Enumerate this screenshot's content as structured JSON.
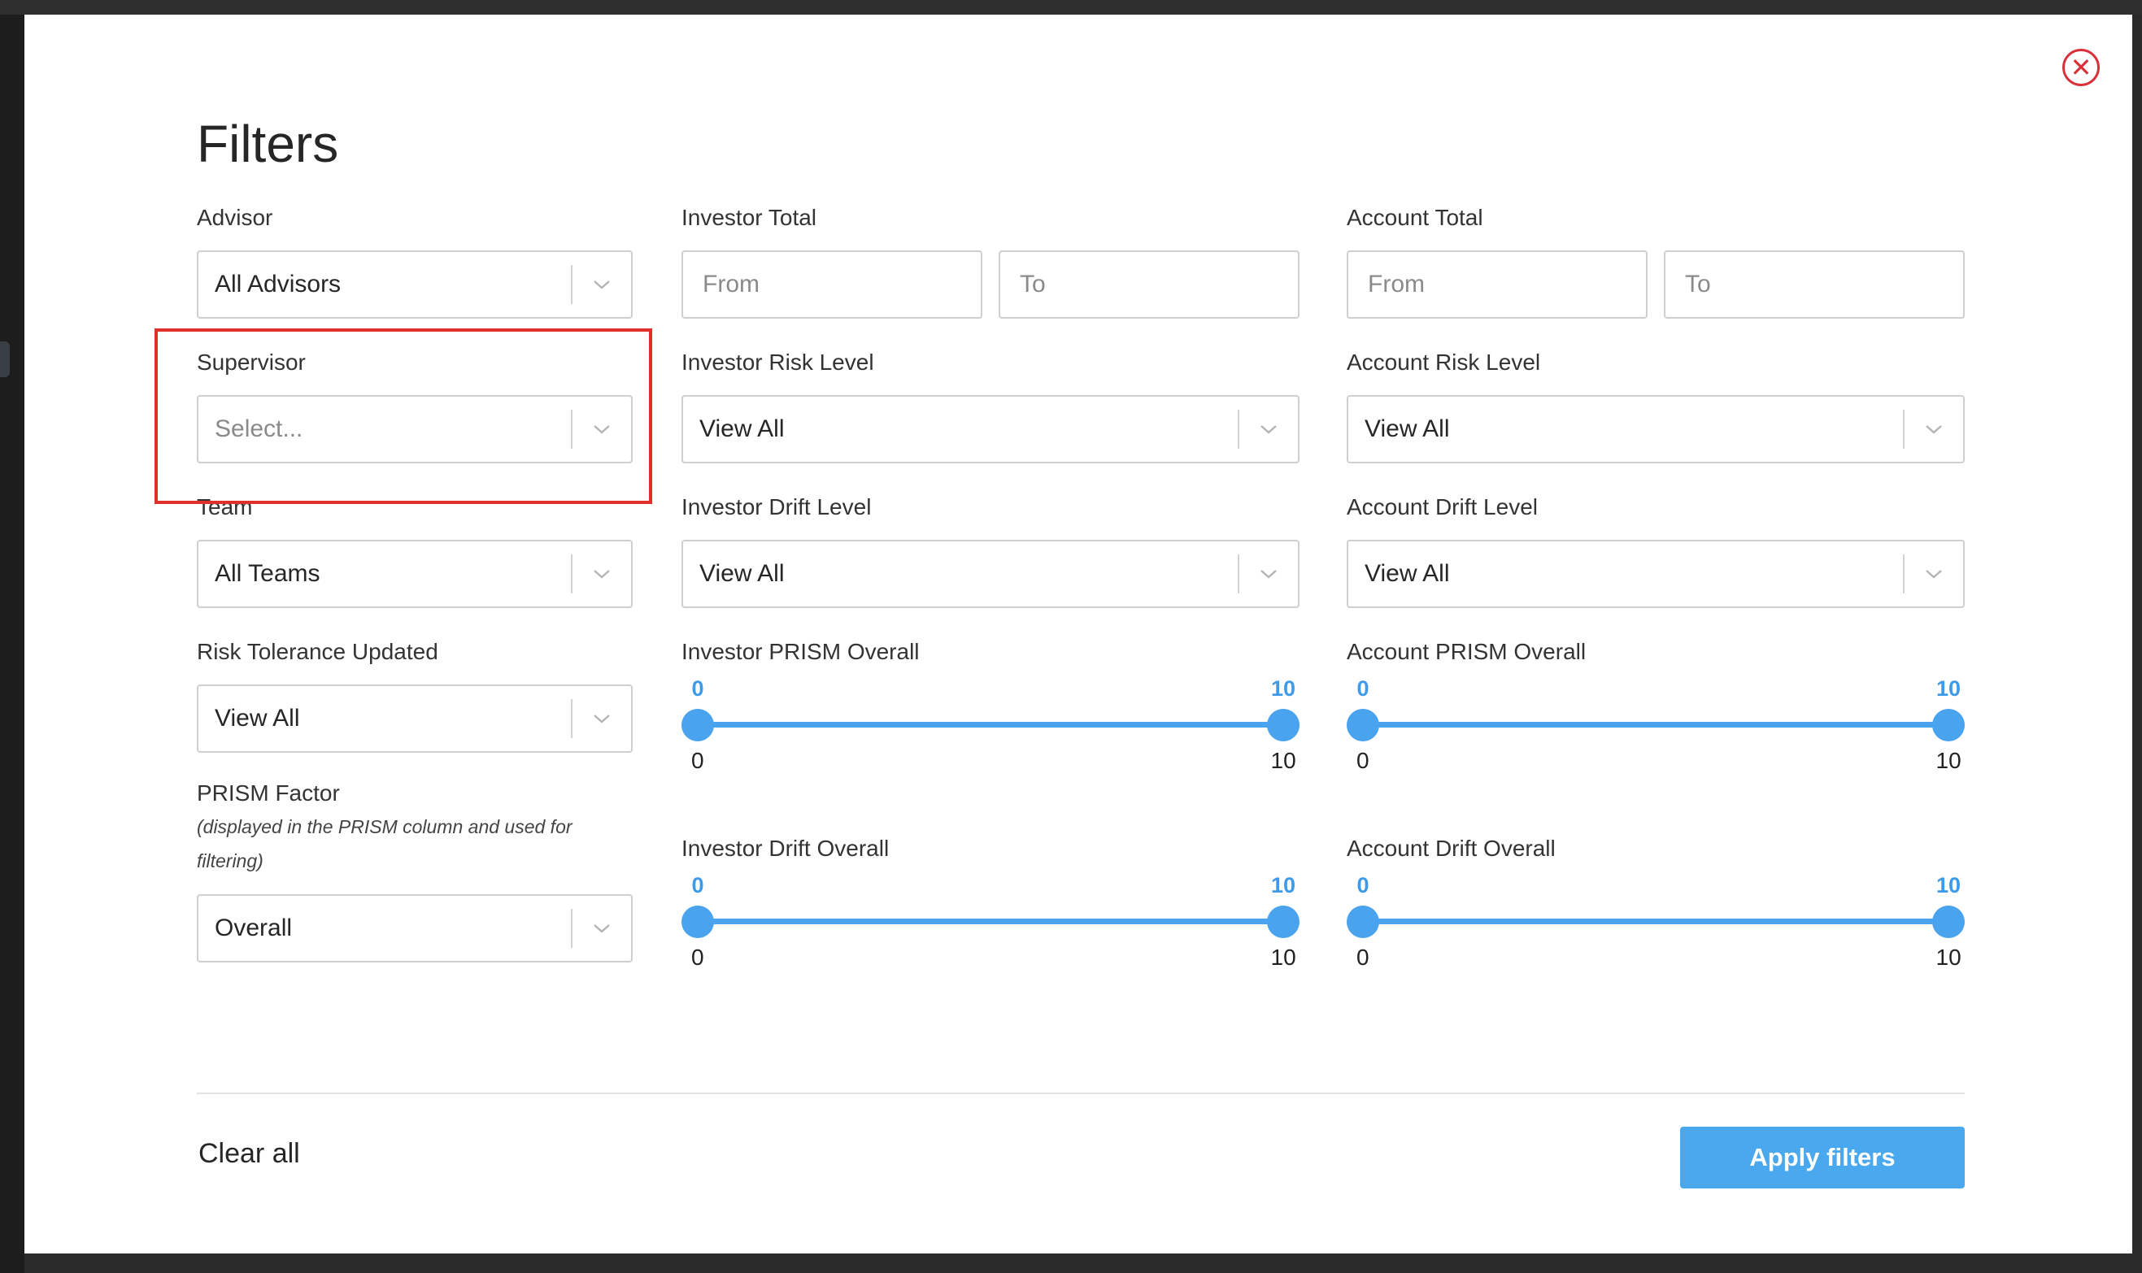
{
  "modal": {
    "title": "Filters",
    "close_icon": "close-circle-icon"
  },
  "colors": {
    "accent": "#4aa8ee",
    "slider": "#4aa3ef",
    "close": "#d9303a",
    "highlight": "#e0302a"
  },
  "advisor": {
    "label": "Advisor",
    "value": "All Advisors"
  },
  "supervisor": {
    "label": "Supervisor",
    "placeholder": "Select..."
  },
  "team": {
    "label": "Team",
    "value": "All Teams"
  },
  "risk_tolerance_updated": {
    "label": "Risk Tolerance Updated",
    "value": "View All"
  },
  "prism_factor": {
    "label": "PRISM Factor",
    "note": "(displayed in the PRISM column and used for filtering)",
    "value": "Overall"
  },
  "investor_total": {
    "label": "Investor Total",
    "from_placeholder": "From",
    "to_placeholder": "To"
  },
  "investor_risk_level": {
    "label": "Investor Risk Level",
    "value": "View All"
  },
  "investor_drift_level": {
    "label": "Investor Drift Level",
    "value": "View All"
  },
  "investor_prism_overall": {
    "label": "Investor PRISM Overall",
    "low": 0,
    "high": 10,
    "min_label": "0",
    "max_label": "10"
  },
  "investor_drift_overall": {
    "label": "Investor Drift Overall",
    "low": 0,
    "high": 10,
    "min_label": "0",
    "max_label": "10"
  },
  "account_total": {
    "label": "Account Total",
    "from_placeholder": "From",
    "to_placeholder": "To"
  },
  "account_risk_level": {
    "label": "Account Risk Level",
    "value": "View All"
  },
  "account_drift_level": {
    "label": "Account Drift Level",
    "value": "View All"
  },
  "account_prism_overall": {
    "label": "Account PRISM Overall",
    "low": 0,
    "high": 10,
    "min_label": "0",
    "max_label": "10"
  },
  "account_drift_overall": {
    "label": "Account Drift Overall",
    "low": 0,
    "high": 10,
    "min_label": "0",
    "max_label": "10"
  },
  "footer": {
    "clear_label": "Clear all",
    "apply_label": "Apply filters"
  }
}
